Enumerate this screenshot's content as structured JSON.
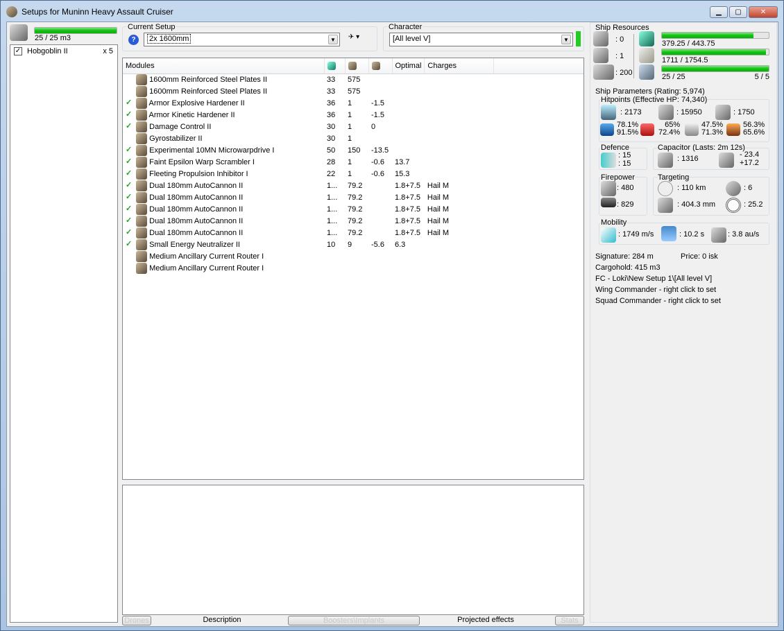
{
  "window": {
    "title": "Setups for Muninn Heavy Assault Cruiser",
    "min": "▁",
    "max": "▢",
    "close": "✕"
  },
  "drones": {
    "bandwidth": "25 / 25 m3",
    "bandwidth_fill": 1.0,
    "items": [
      {
        "name": "Hobgoblin II",
        "qty": "x 5",
        "checked": true
      }
    ]
  },
  "setup": {
    "label": "Current Setup",
    "value": "2x 1600mm"
  },
  "character": {
    "label": "Character",
    "value": "[All level V]",
    "status_color": "#22cc22"
  },
  "modules": {
    "headers": [
      "Modules",
      "CPU",
      "Powergrid",
      "Capacitor",
      "Optimal",
      "Charges"
    ],
    "rows": [
      {
        "active": false,
        "name": "1600mm Reinforced Steel Plates II",
        "cpu": "33",
        "pg": "575",
        "cap": "",
        "opt": "",
        "charge": ""
      },
      {
        "active": false,
        "name": "1600mm Reinforced Steel Plates II",
        "cpu": "33",
        "pg": "575",
        "cap": "",
        "opt": "",
        "charge": ""
      },
      {
        "active": true,
        "name": "Armor Explosive Hardener II",
        "cpu": "36",
        "pg": "1",
        "cap": "-1.5",
        "opt": "",
        "charge": ""
      },
      {
        "active": true,
        "name": "Armor Kinetic Hardener II",
        "cpu": "36",
        "pg": "1",
        "cap": "-1.5",
        "opt": "",
        "charge": ""
      },
      {
        "active": true,
        "name": "Damage Control II",
        "cpu": "30",
        "pg": "1",
        "cap": "0",
        "opt": "",
        "charge": ""
      },
      {
        "active": false,
        "name": "Gyrostabilizer II",
        "cpu": "30",
        "pg": "1",
        "cap": "",
        "opt": "",
        "charge": ""
      },
      {
        "active": true,
        "name": "Experimental 10MN Microwarpdrive I",
        "cpu": "50",
        "pg": "150",
        "cap": "-13.5",
        "opt": "",
        "charge": ""
      },
      {
        "active": true,
        "name": "Faint Epsilon Warp Scrambler I",
        "cpu": "28",
        "pg": "1",
        "cap": "-0.6",
        "opt": "13.7",
        "charge": ""
      },
      {
        "active": true,
        "name": "Fleeting Propulsion Inhibitor I",
        "cpu": "22",
        "pg": "1",
        "cap": "-0.6",
        "opt": "15.3",
        "charge": ""
      },
      {
        "active": true,
        "name": "Dual 180mm AutoCannon II",
        "cpu": "1...",
        "pg": "79.2",
        "cap": "",
        "opt": "1.8+7.5",
        "charge": "Hail M"
      },
      {
        "active": true,
        "name": "Dual 180mm AutoCannon II",
        "cpu": "1...",
        "pg": "79.2",
        "cap": "",
        "opt": "1.8+7.5",
        "charge": "Hail M"
      },
      {
        "active": true,
        "name": "Dual 180mm AutoCannon II",
        "cpu": "1...",
        "pg": "79.2",
        "cap": "",
        "opt": "1.8+7.5",
        "charge": "Hail M"
      },
      {
        "active": true,
        "name": "Dual 180mm AutoCannon II",
        "cpu": "1...",
        "pg": "79.2",
        "cap": "",
        "opt": "1.8+7.5",
        "charge": "Hail M"
      },
      {
        "active": true,
        "name": "Dual 180mm AutoCannon II",
        "cpu": "1...",
        "pg": "79.2",
        "cap": "",
        "opt": "1.8+7.5",
        "charge": "Hail M"
      },
      {
        "active": true,
        "name": "Small Energy Neutralizer II",
        "cpu": "10",
        "pg": "9",
        "cap": "-5.6",
        "opt": "6.3",
        "charge": ""
      },
      {
        "active": false,
        "name": "Medium Ancillary Current Router I",
        "cpu": "",
        "pg": "",
        "cap": "",
        "opt": "",
        "charge": ""
      },
      {
        "active": false,
        "name": "Medium Ancillary Current Router I",
        "cpu": "",
        "pg": "",
        "cap": "",
        "opt": "",
        "charge": ""
      }
    ]
  },
  "tabs": [
    "Drones",
    "Description",
    "Boosters\\Implants",
    "Projected effects",
    "Stats"
  ],
  "resources": {
    "label": "Ship Resources",
    "turrets": ": 0",
    "launchers": ": 1",
    "calibration": ": 200",
    "cpu": "379.25 / 443.75",
    "cpu_fill": 0.855,
    "pg": "1711 / 1754.5",
    "pg_fill": 0.975,
    "drone_bw": "25 / 25",
    "drone_count": "5 / 5",
    "drone_fill": 1.0
  },
  "params": {
    "label": "Ship Parameters (Rating: 5,974)",
    "hp_label": "Hitpoints (Effective HP: 74,340)",
    "shield": ": 2173",
    "armor": ": 15950",
    "hull": ": 1750",
    "res": [
      [
        "78.1%",
        "91.5%"
      ],
      [
        "65%",
        "72.4%"
      ],
      [
        "47.5%",
        "71.3%"
      ],
      [
        "56.3%",
        "65.6%"
      ]
    ],
    "defence_label": "Defence",
    "def1": ": 15",
    "def2": ": 15",
    "cap_label": "Capacitor (Lasts: 2m 12s)",
    "cap": ": 1316",
    "cap_use": "- 23.4",
    "cap_regen": "+17.2",
    "fire_label": "Firepower",
    "dps": ": 480",
    "volley": ": 829",
    "targ_label": "Targeting",
    "range": ": 110 km",
    "targets": ": 6",
    "sensor": ": 404.3 mm",
    "scanres": ": 25.2",
    "mob_label": "Mobility",
    "speed": ": 1749 m/s",
    "align": ": 10.2 s",
    "warp": ": 3.8 au/s"
  },
  "info": [
    "Signature: 284 m",
    "Price: 0 isk",
    "Cargohold: 415 m3",
    "FC - Loki\\New Setup 1\\[All level V]",
    "Wing Commander - right click to set",
    "Squad Commander - right click to set"
  ]
}
